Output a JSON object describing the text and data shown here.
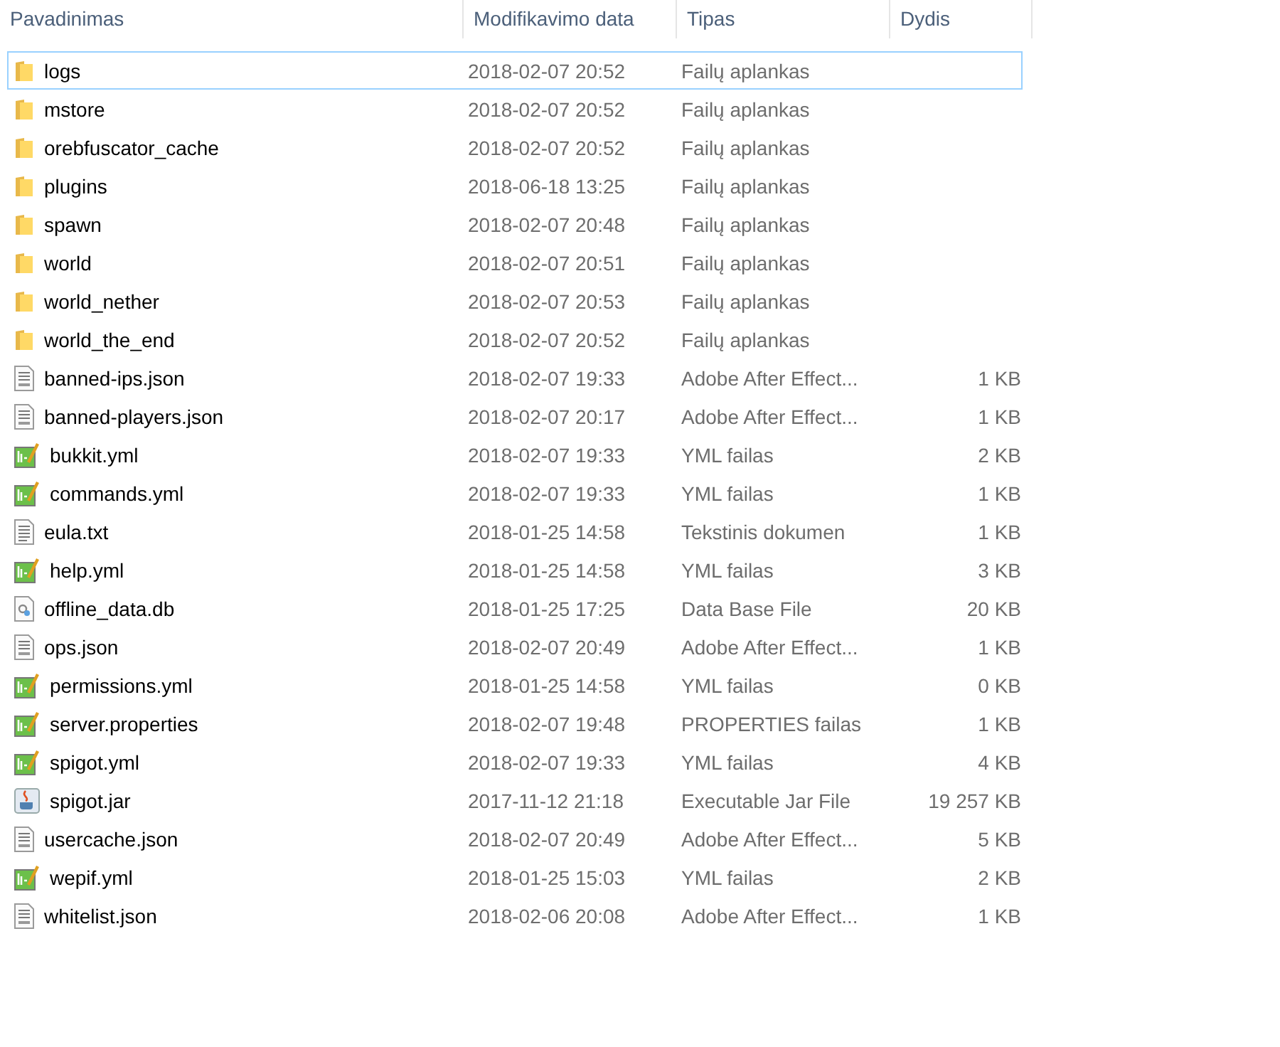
{
  "columns": [
    "Pavadinimas",
    "Modifikavimo data",
    "Tipas",
    "Dydis"
  ],
  "rows": [
    {
      "kind": "folder",
      "name": "logs",
      "date": "2018-02-07 20:52",
      "type": "Failų aplankas",
      "focused": true
    },
    {
      "kind": "folder",
      "name": "mstore",
      "date": "2018-02-07 20:52",
      "type": "Failų aplankas",
      "focused": false
    },
    {
      "kind": "folder",
      "name": "orebfuscator_cache",
      "date": "2018-02-07 20:52",
      "type": "Failų aplankas",
      "focused": false
    },
    {
      "kind": "folder",
      "name": "plugins",
      "date": "2018-06-18 13:25",
      "type": "Failų aplankas",
      "focused": false
    },
    {
      "kind": "folder",
      "name": "spawn",
      "date": "2018-02-07 20:48",
      "type": "Failų aplankas",
      "focused": false
    },
    {
      "kind": "folder",
      "name": "world",
      "date": "2018-02-07 20:51",
      "type": "Failų aplankas",
      "focused": false
    },
    {
      "kind": "folder",
      "name": "world_nether",
      "date": "2018-02-07 20:53",
      "type": "Failų aplankas",
      "focused": false
    },
    {
      "kind": "folder",
      "name": "world_the_end",
      "date": "2018-02-07 20:52",
      "type": "Failų aplankas",
      "focused": false
    },
    {
      "kind": "json",
      "name": "banned-ips.json",
      "date": "2018-02-07 19:33",
      "type": "Adobe After Effect...",
      "size": "1 KB",
      "focused": false
    },
    {
      "kind": "json",
      "name": "banned-players.json",
      "date": "2018-02-07 20:17",
      "type": "Adobe After Effect...",
      "size": "1 KB",
      "focused": false
    },
    {
      "kind": "yml",
      "name": "bukkit.yml",
      "date": "2018-02-07 19:33",
      "type": "YML failas",
      "size": "2 KB",
      "focused": false
    },
    {
      "kind": "yml",
      "name": "commands.yml",
      "date": "2018-02-07 19:33",
      "type": "YML failas",
      "size": "1 KB",
      "focused": false
    },
    {
      "kind": "txt",
      "name": "eula.txt",
      "date": "2018-01-25 14:58",
      "type": "Tekstinis dokumen",
      "size": "1 KB",
      "focused": false
    },
    {
      "kind": "yml",
      "name": "help.yml",
      "date": "2018-01-25 14:58",
      "type": "YML failas",
      "size": "3 KB",
      "focused": false
    },
    {
      "kind": "db",
      "name": "offline_data.db",
      "date": "2018-01-25 17:25",
      "type": "Data Base File",
      "size": "20 KB",
      "focused": false
    },
    {
      "kind": "json",
      "name": "ops.json",
      "date": "2018-02-07 20:49",
      "type": "Adobe After Effect...",
      "size": "1 KB",
      "focused": false
    },
    {
      "kind": "yml",
      "name": "permissions.yml",
      "date": "2018-01-25 14:58",
      "type": "YML failas",
      "size": "0 KB",
      "focused": false
    },
    {
      "kind": "yml",
      "name": "server.properties",
      "date": "2018-02-07 19:48",
      "type": "PROPERTIES failas",
      "size": "1 KB",
      "focused": false
    },
    {
      "kind": "yml",
      "name": "spigot.yml",
      "date": "2018-02-07 19:33",
      "type": "YML failas",
      "size": "4 KB",
      "focused": false
    },
    {
      "kind": "jar",
      "name": "spigot.jar",
      "date": "2017-11-12 21:18",
      "type": "Executable Jar File",
      "size": "19 257 KB",
      "focused": false
    },
    {
      "kind": "json",
      "name": "usercache.json",
      "date": "2018-02-07 20:49",
      "type": "Adobe After Effect...",
      "size": "5 KB",
      "focused": false
    },
    {
      "kind": "yml",
      "name": "wepif.yml",
      "date": "2018-01-25 15:03",
      "type": "YML failas",
      "size": "2 KB",
      "focused": false
    },
    {
      "kind": "json",
      "name": "whitelist.json",
      "date": "2018-02-06 20:08",
      "type": "Adobe After Effect...",
      "size": "1 KB",
      "focused": false
    }
  ]
}
